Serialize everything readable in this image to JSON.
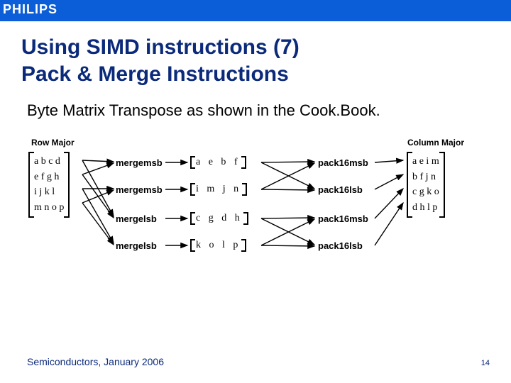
{
  "brand": "PHILIPS",
  "title_line1": "Using SIMD instructions (7)",
  "title_line2": "Pack & Merge Instructions",
  "body": "Byte Matrix Transpose as shown in the Cook.Book.",
  "diagram": {
    "left_label": "Row Major",
    "right_label": "Column Major",
    "input_rows": [
      "a  b  c  d",
      "e  f  g  h",
      "i  j  k  l",
      "m  n  o  p"
    ],
    "merge_ops": [
      "mergemsb",
      "mergemsb",
      "mergelsb",
      "mergelsb"
    ],
    "mid_rows": [
      "a e b f",
      "i m j n",
      "c g d h",
      "k o l p"
    ],
    "pack_ops": [
      "pack16msb",
      "pack16lsb",
      "pack16msb",
      "pack16lsb"
    ],
    "output_rows": [
      "a  e  i  m",
      "b  f  j  n",
      "c  g  k  o",
      "d  h  l  p"
    ]
  },
  "footer": "Semiconductors, January 2006",
  "page_number": "14"
}
